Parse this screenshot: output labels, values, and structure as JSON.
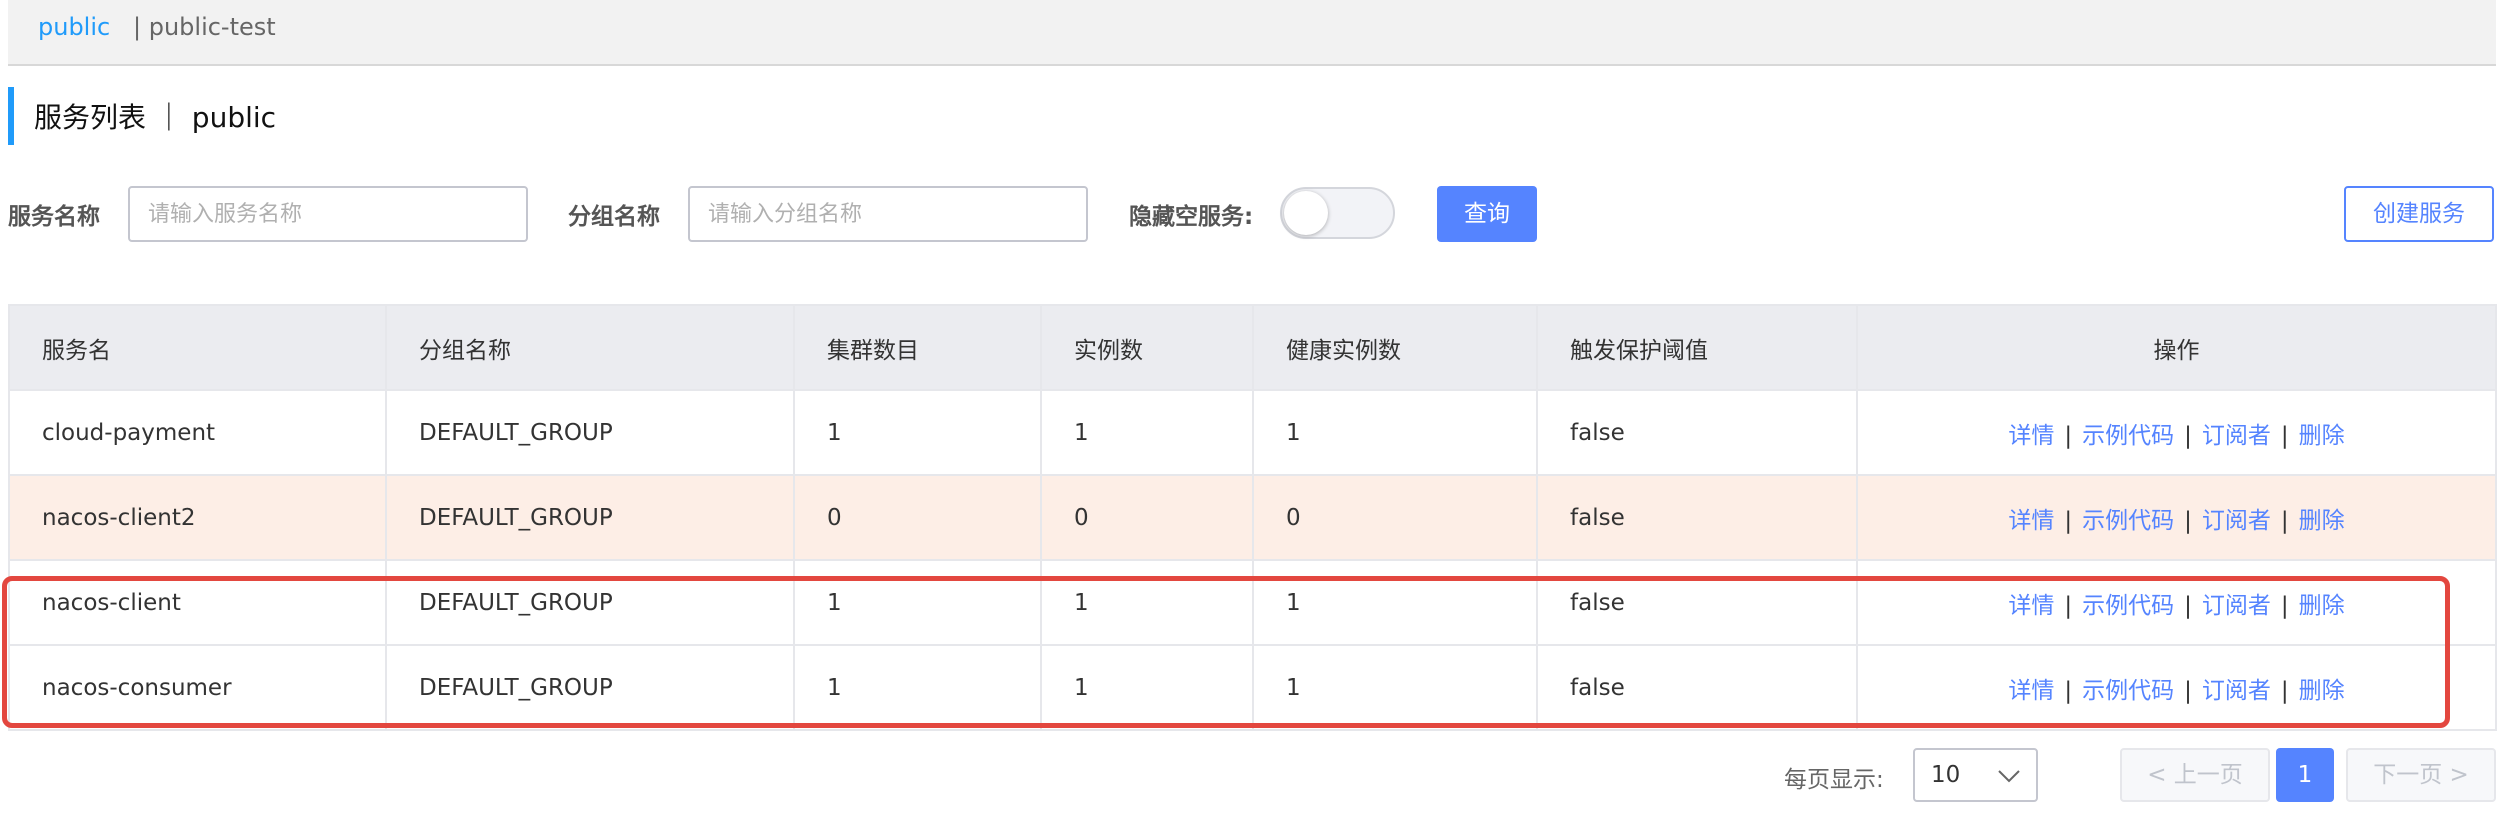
{
  "namespace": {
    "active": "public",
    "other": "| public-test"
  },
  "page": {
    "title": "服务列表 ｜ public"
  },
  "filters": {
    "service_name_label": "服务名称",
    "service_name_placeholder": "请输入服务名称",
    "group_name_label": "分组名称",
    "group_name_placeholder": "请输入分组名称",
    "hide_empty_label": "隐藏空服务:",
    "hide_empty_on": false,
    "query_button": "查询",
    "create_button": "创建服务"
  },
  "table": {
    "columns": [
      "服务名",
      "分组名称",
      "集群数目",
      "实例数",
      "健康实例数",
      "触发保护阈值",
      "操作"
    ],
    "rows": [
      {
        "name": "cloud-payment",
        "group": "DEFAULT_GROUP",
        "clusters": "1",
        "instances": "1",
        "healthy": "1",
        "protect": "false"
      },
      {
        "name": "nacos-client2",
        "group": "DEFAULT_GROUP",
        "clusters": "0",
        "instances": "0",
        "healthy": "0",
        "protect": "false"
      },
      {
        "name": "nacos-client",
        "group": "DEFAULT_GROUP",
        "clusters": "1",
        "instances": "1",
        "healthy": "1",
        "protect": "false"
      },
      {
        "name": "nacos-consumer",
        "group": "DEFAULT_GROUP",
        "clusters": "1",
        "instances": "1",
        "healthy": "1",
        "protect": "false"
      }
    ],
    "ops": {
      "detail": "详情",
      "sample": "示例代码",
      "subscribers": "订阅者",
      "delete": "删除",
      "separator": "|"
    }
  },
  "pagination": {
    "per_page_label": "每页显示:",
    "per_page_value": "10",
    "prev": "上一页",
    "next": "下一页",
    "current_page": "1"
  },
  "colors": {
    "accent": "#5584ff",
    "namespace_active": "#209bfa",
    "highlight_row": "#fdeee6",
    "annotation_box": "#e3473f"
  }
}
